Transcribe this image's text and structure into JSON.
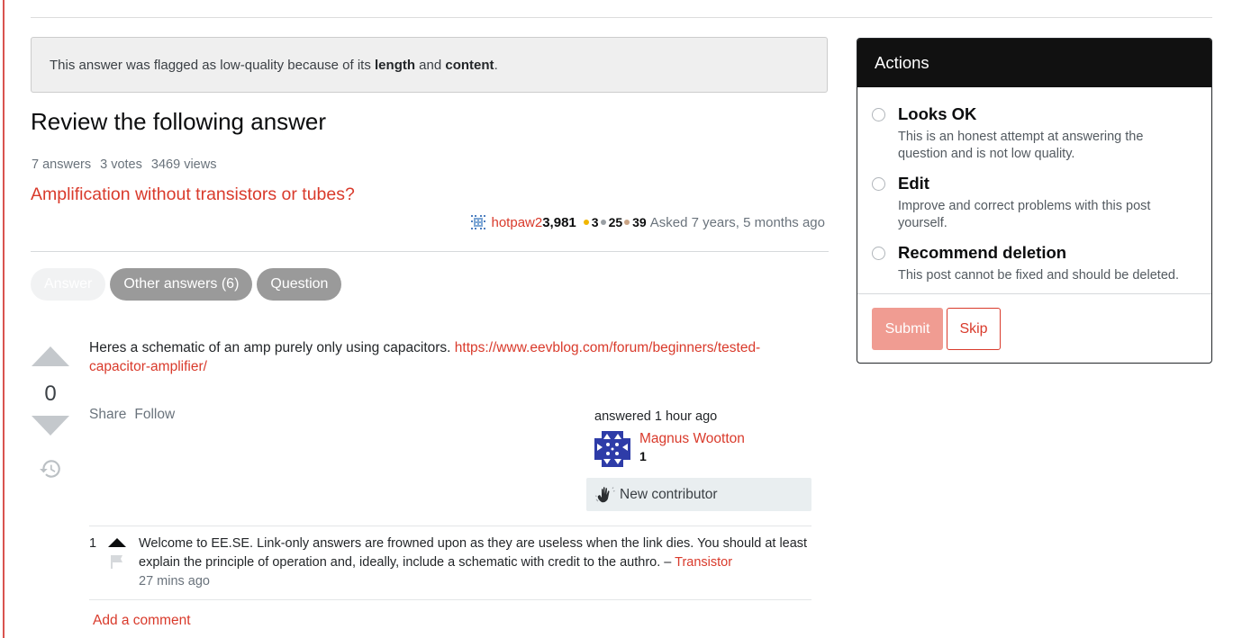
{
  "notice": {
    "prefix": "This answer was flagged as low-quality because of its ",
    "bold1": "length",
    "middle": " and ",
    "bold2": "content",
    "suffix": "."
  },
  "page_title": "Review the following answer",
  "question_stats": {
    "answers": "7 answers",
    "votes": "3 votes",
    "views": "3469 views"
  },
  "question": {
    "title": "Amplification without transistors or tubes?",
    "owner": {
      "name": "hotpaw2",
      "reputation": "3,981",
      "badges": {
        "gold": "3",
        "silver": "25",
        "bronze": "39"
      },
      "asked": "Asked 7 years, 5 months ago"
    }
  },
  "tabs": [
    {
      "label": "Answer",
      "active": true
    },
    {
      "label": "Other answers (6)",
      "active": false
    },
    {
      "label": "Question",
      "active": false
    }
  ],
  "answer": {
    "vote_count": "0",
    "body_text": "Heres a schematic of an amp purely only using capacitors. ",
    "link_text": "https://www.eevblog.com/forum/beginners/tested-capacitor-amplifier/",
    "menu": {
      "share": "Share",
      "follow": "Follow"
    },
    "answered": "answered 1 hour ago",
    "author": {
      "name": "Magnus Wootton",
      "reputation": "1"
    },
    "new_contributor": "New contributor"
  },
  "comments": [
    {
      "score": "1",
      "text": "Welcome to EE.SE. Link-only answers are frowned upon as they are useless when the link dies. You should at least explain the principle of operation and, ideally, include a schematic with credit to the authro. – ",
      "author": "Transistor",
      "date": "27 mins ago"
    }
  ],
  "add_comment": "Add a comment",
  "actions_panel": {
    "title": "Actions",
    "options": [
      {
        "title": "Looks OK",
        "description": "This is an honest attempt at answering the question and is not low quality."
      },
      {
        "title": "Edit",
        "description": "Improve and correct problems with this post yourself."
      },
      {
        "title": "Recommend deletion",
        "description": "This post cannot be fixed and should be deleted."
      }
    ],
    "submit_label": "Submit",
    "skip_label": "Skip"
  },
  "colors": {
    "accent": "#d93a2b",
    "badge_gold": "#f1b600",
    "badge_silver": "#9a9fa4",
    "badge_bronze": "#c9a384",
    "panel_header": "#111111",
    "submit_disabled": "#f09c92"
  }
}
